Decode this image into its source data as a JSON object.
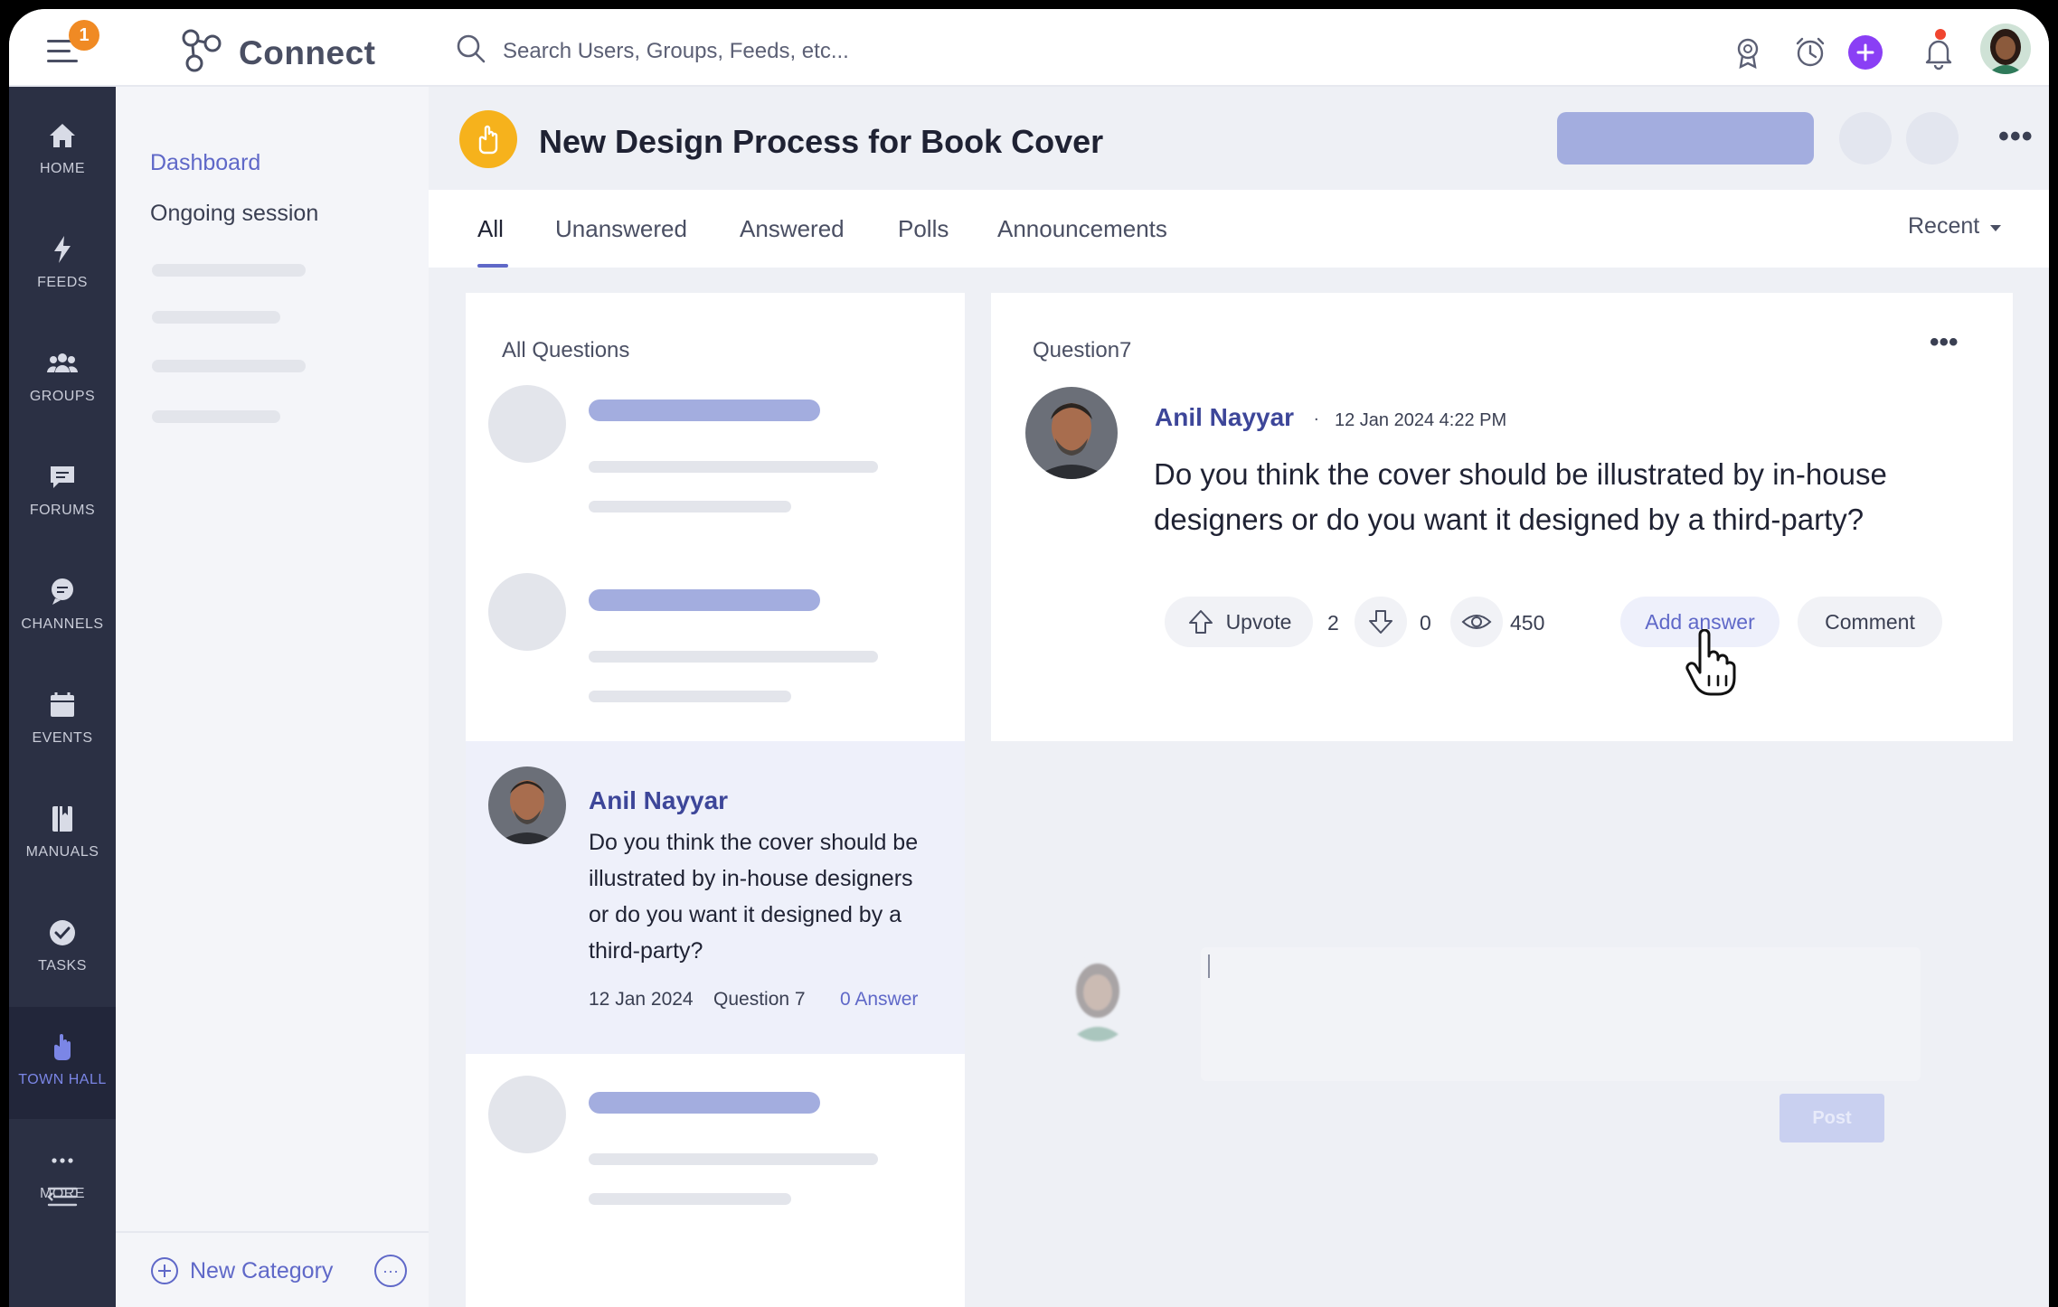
{
  "app": {
    "name": "Connect",
    "notification_count": "1",
    "search_placeholder": "Search Users, Groups, Feeds, etc..."
  },
  "nav": [
    {
      "label": "HOME",
      "icon": "home-icon"
    },
    {
      "label": "FEEDS",
      "icon": "bolt-icon"
    },
    {
      "label": "GROUPS",
      "icon": "groups-icon"
    },
    {
      "label": "FORUMS",
      "icon": "forum-icon"
    },
    {
      "label": "CHANNELS",
      "icon": "channel-icon"
    },
    {
      "label": "EVENTS",
      "icon": "calendar-icon"
    },
    {
      "label": "MANUALS",
      "icon": "manual-icon"
    },
    {
      "label": "TASKS",
      "icon": "check-icon"
    },
    {
      "label": "TOWN HALL",
      "icon": "hand-icon",
      "active": true
    },
    {
      "label": "MORE",
      "icon": "more-icon"
    }
  ],
  "sidebar": {
    "dashboard": "Dashboard",
    "ongoing": "Ongoing session",
    "new_category": "New Category",
    "more_symbol": "···"
  },
  "header": {
    "title": "New Design Process for Book Cover",
    "more_symbol": "•••"
  },
  "tabs": [
    "All",
    "Unanswered",
    "Answered",
    "Polls",
    "Announcements"
  ],
  "active_tab": "All",
  "sort": {
    "label": "Recent"
  },
  "question_list": {
    "title": "All Questions",
    "active_item": {
      "author": "Anil Nayyar",
      "text": "Do you think the cover should be illustrated by in-house designers or do you want it designed by a third-party?",
      "date": "12 Jan 2024",
      "question_no": "Question 7",
      "answers": "0 Answer"
    }
  },
  "detail": {
    "label": "Question7",
    "more_symbol": "•••",
    "author": "Anil Nayyar",
    "separator": ".",
    "datetime": "12 Jan 2024   4:22 PM",
    "question": "Do you think the cover should be illustrated by in-house designers or do you want it designed by a third-party?",
    "upvote_label": "Upvote",
    "upvotes": "2",
    "downvotes": "0",
    "views": "450",
    "add_answer_label": "Add answer",
    "comment_label": "Comment",
    "post_label": "Post"
  },
  "colors": {
    "accent": "#5f68c8",
    "rail": "#2b3044",
    "badge": "#f08a24",
    "townhall_badge": "#f6b21c",
    "plus": "#8a3ff5"
  }
}
